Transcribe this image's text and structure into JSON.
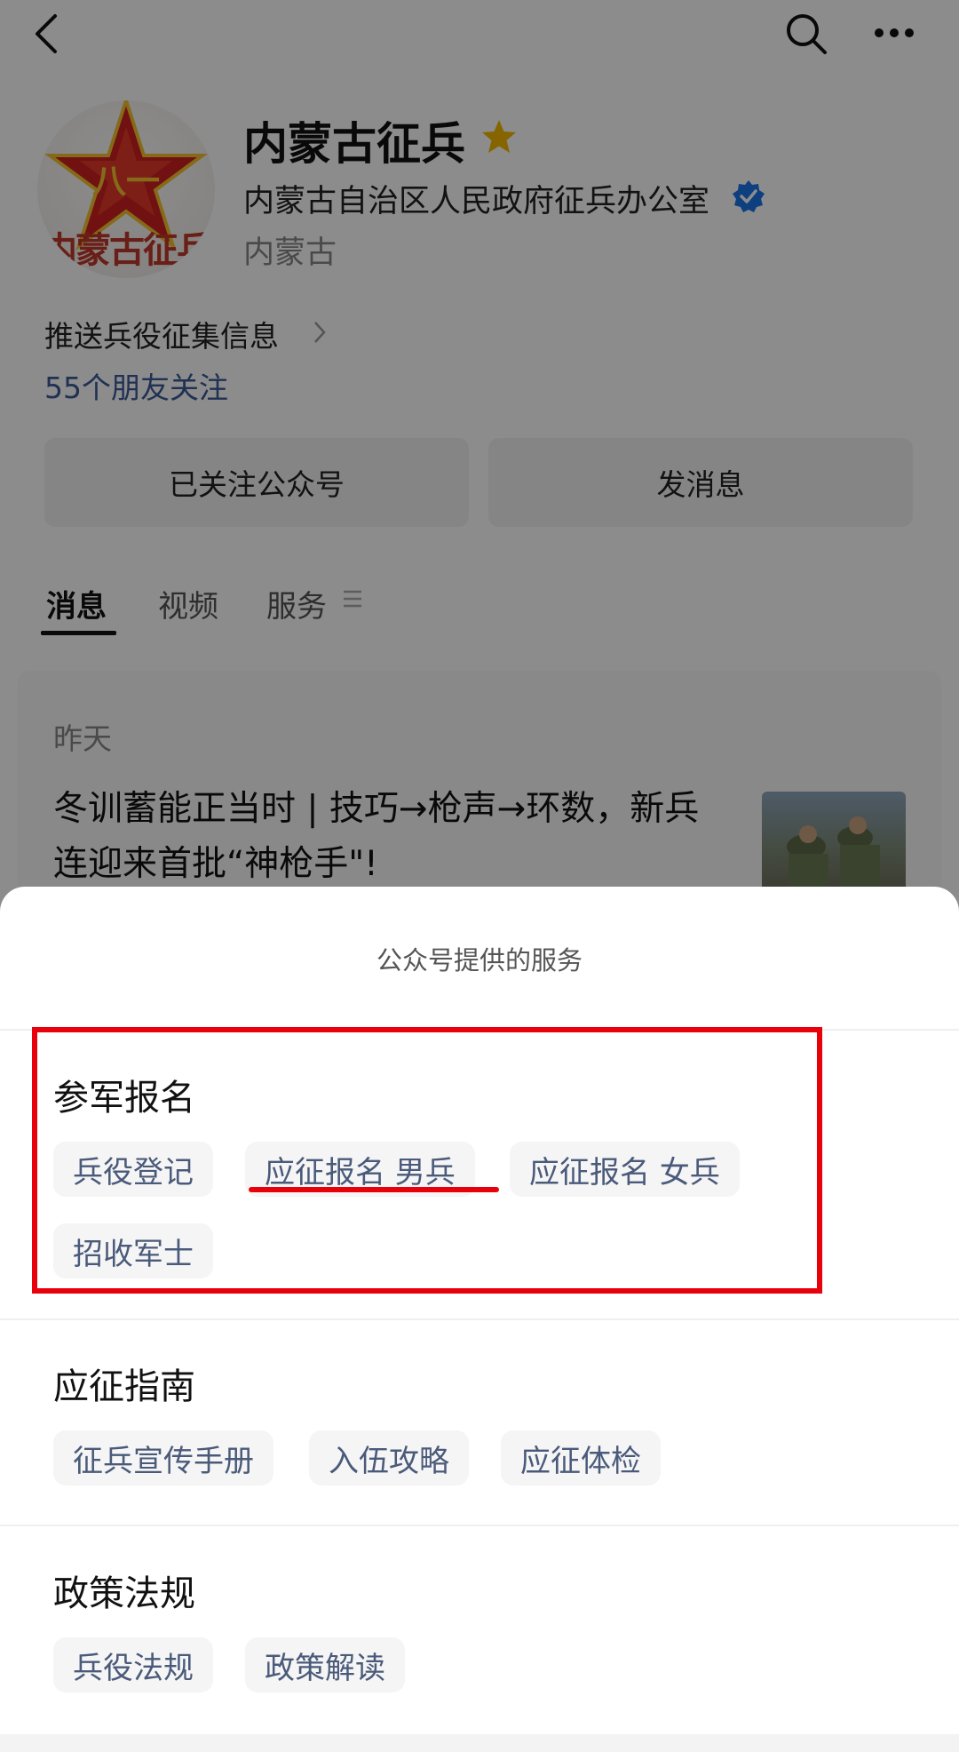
{
  "header": {
    "icons": [
      "back-icon",
      "search-icon",
      "more-icon"
    ]
  },
  "profile": {
    "avatar_text": "内蒙古征兵",
    "name": "内蒙古征兵",
    "organization": "内蒙古自治区人民政府征兵办公室",
    "region": "内蒙古",
    "push_info": "推送兵役征集信息",
    "friends_following": "55个朋友关注",
    "follow_button": "已关注公众号",
    "message_button": "发消息",
    "colors": {
      "star": "#f5b800",
      "verified": "#1a73e8",
      "link": "#3b5998"
    }
  },
  "tabs": [
    {
      "label": "消息",
      "active": true
    },
    {
      "label": "视频",
      "active": false
    },
    {
      "label": "服务",
      "active": false
    }
  ],
  "feed": {
    "date": "昨天",
    "article_title": "冬训蓄能正当时 | 技巧→枪声→环数，新兵连迎来首批“神枪手\"!"
  },
  "service_sheet": {
    "title": "公众号提供的服务",
    "sections": [
      {
        "title": "参军报名",
        "items": [
          "兵役登记",
          "应征报名 男兵",
          "应征报名 女兵",
          "招收军士"
        ]
      },
      {
        "title": "应征指南",
        "items": [
          "征兵宣传手册",
          "入伍攻略",
          "应征体检"
        ]
      },
      {
        "title": "政策法规",
        "items": [
          "兵役法规",
          "政策解读"
        ]
      }
    ],
    "highlight_color": "#e8000b"
  }
}
